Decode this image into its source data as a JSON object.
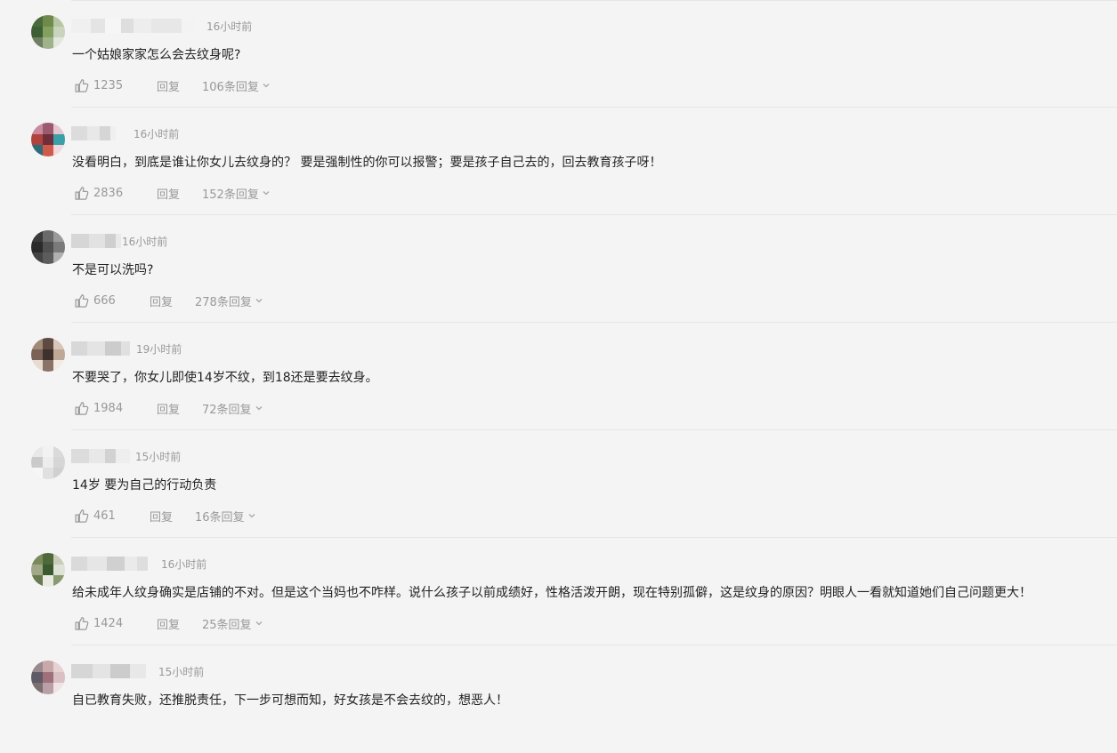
{
  "ui": {
    "reply_label": "回复"
  },
  "comments": [
    {
      "time": "16小时前",
      "text": "一个姑娘家家怎么会去纹身呢?",
      "likes": "1235",
      "replies": "106条回复",
      "avatar_colors": [
        "#4a6a3c",
        "#6f8a4c",
        "#b6c6a2",
        "#3e5e34",
        "#83a05e",
        "#c9d3bd",
        "#6f7f62",
        "#9fb38a",
        "#e2e6dc"
      ],
      "name_colors": [
        "#f0f0f0",
        "#e4e4e4",
        "#f6f6f6",
        "#dedede",
        "#ededed",
        "#e7e7e7",
        "#f3f3f3"
      ]
    },
    {
      "time": "16小时前",
      "text": "没看明白，到底是谁让你女儿去纹身的？ 要是强制性的你可以报警；要是孩子自己去的，回去教育孩子呀！",
      "likes": "2836",
      "replies": "152条回复",
      "avatar_colors": [
        "#c98aa0",
        "#9b5a6e",
        "#e6c4d0",
        "#b0433e",
        "#6e2e3a",
        "#3aa0a8",
        "#2d6d7a",
        "#d05a4a",
        "#f0d8dc"
      ],
      "name_colors": [
        "#dcdcdc",
        "#e8e8e8",
        "#d5d5d5",
        "#efefef"
      ]
    },
    {
      "time": "16小时前",
      "text": "不是可以洗吗?",
      "likes": "666",
      "replies": "278条回复",
      "avatar_colors": [
        "#3a3a3a",
        "#6a6a6a",
        "#9a9a9a",
        "#2a2a2a",
        "#505050",
        "#7a7a7a",
        "#444444",
        "#5c5c5c",
        "#b0b0b0"
      ],
      "name_colors": [
        "#d6d6d6",
        "#e2e2e2",
        "#cfcfcf",
        "#e9e9e9"
      ]
    },
    {
      "time": "19小时前",
      "text": "不要哭了，你女儿即使14岁不纹，到18还是要去纹身。",
      "likes": "1984",
      "replies": "72条回复",
      "avatar_colors": [
        "#a08a7a",
        "#5e4a40",
        "#d8c6b8",
        "#7a6256",
        "#3e302a",
        "#c0a898",
        "#e8dcd2",
        "#8a7266",
        "#f2ebe4"
      ],
      "name_colors": [
        "#d8d8d8",
        "#e4e4e4",
        "#cccccc",
        "#e0e0e0"
      ]
    },
    {
      "time": "15小时前",
      "text": "14岁 要为自己的行动负责",
      "likes": "461",
      "replies": "16条回复",
      "avatar_colors": [
        "#e8e8e8",
        "#f2f2f2",
        "#dadada",
        "#cacaca",
        "#ededed",
        "#d6d6d6",
        "#f6f6f6",
        "#e0e0e0",
        "#d0d0d0"
      ],
      "name_colors": [
        "#dcdcdc",
        "#e8e8e8",
        "#d2d2d2",
        "#eeeeee"
      ]
    },
    {
      "time": "16小时前",
      "text": "给未成年人纹身确实是店铺的不对。但是这个当妈也不咋样。说什么孩子以前成绩好，性格活泼开朗，现在特别孤僻，这是纹身的原因？明眼人一看就知道她们自己问题更大！",
      "likes": "1424",
      "replies": "25条回复",
      "avatar_colors": [
        "#7a8a5a",
        "#4e6a3a",
        "#c8ccb8",
        "#a0a888",
        "#3c5a30",
        "#dfe2d6",
        "#6a7a4e",
        "#e9ebe2",
        "#8a9a6e"
      ],
      "name_colors": [
        "#dadada",
        "#e6e6e6",
        "#d0d0d0",
        "#eaeaea",
        "#dedede"
      ]
    },
    {
      "time": "15小时前",
      "text": "自已教育失败，还推脱责任，下一步可想而知，好女孩是不会去纹的，想恶人！",
      "likes": "",
      "replies": "",
      "avatar_colors": [
        "#9a8a90",
        "#c8a8a8",
        "#e6d2d2",
        "#5e5a66",
        "#a0707a",
        "#d8c0c4",
        "#7a7070",
        "#b8a0a6",
        "#efe4e4"
      ],
      "name_colors": [
        "#d6d6d6",
        "#e4e4e4",
        "#cccccc",
        "#e8e8e8"
      ]
    }
  ]
}
